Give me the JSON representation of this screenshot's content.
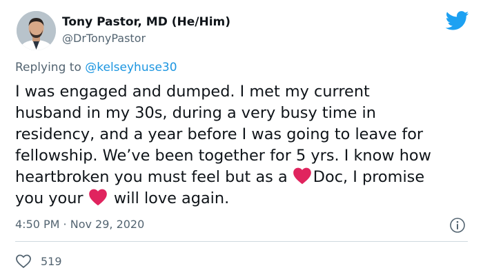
{
  "author": {
    "name": "Tony Pastor, MD (He/Him)",
    "handle": "@DrTonyPastor"
  },
  "reply": {
    "prefix": "Replying to",
    "mention": "@kelseyhuse30"
  },
  "tweet": {
    "lines": [
      "I was engaged and dumped. I met my current",
      "husband in my 30s, during a very busy time in",
      "residency, and a year before I was going to leave for",
      "fellowship. We’ve been together for 5 yrs. I know how"
    ],
    "line5_before": "heartbroken you must feel but as a",
    "line5_after": "Doc, I promise",
    "line6_before": "you your",
    "line6_after": "will love again."
  },
  "meta": {
    "timestamp": "4:50 PM · Nov 29, 2020",
    "like_count": "519"
  },
  "icons": {
    "brand": "twitter-bird-icon",
    "emoji": "red-heart-emoji",
    "info": "info-icon",
    "like": "heart-outline-icon"
  },
  "colors": {
    "brand": "#1da1f2",
    "link": "#1b95e0",
    "heart": "#e0245e",
    "muted": "#536471"
  }
}
